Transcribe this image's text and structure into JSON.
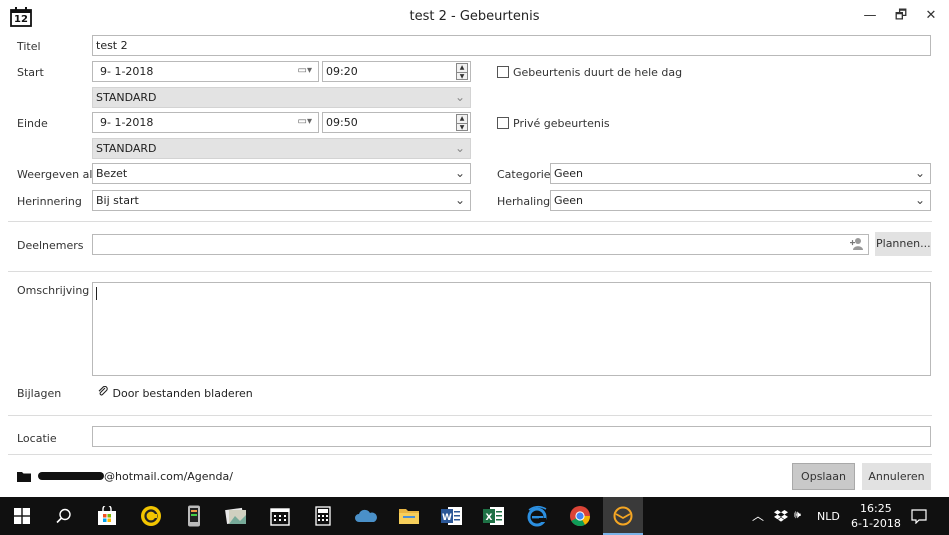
{
  "window": {
    "title": "test 2 - Gebeurtenis",
    "app_icon_text": "12",
    "controls": {
      "minimize": "—",
      "maximize": "🗗",
      "close": "✕"
    }
  },
  "form": {
    "title_label": "Titel",
    "title_value": "test 2",
    "start_label": "Start",
    "start_date": "9-  1-2018",
    "start_time": "09:20",
    "start_timezone": "STANDARD",
    "allday_label": "Gebeurtenis duurt de hele dag",
    "end_label": "Einde",
    "end_date": "9-  1-2018",
    "end_time": "09:50",
    "end_timezone": "STANDARD",
    "private_label": "Privé gebeurtenis",
    "show_as_label": "Weergeven als",
    "show_as_value": "Bezet",
    "category_label": "Categorie",
    "category_value": "Geen",
    "reminder_label": "Herinnering",
    "reminder_value": "Bij start",
    "repeat_label": "Herhaling",
    "repeat_value": "Geen",
    "attendees_label": "Deelnemers",
    "attendees_value": "",
    "plan_button": "Plannen...",
    "description_label": "Omschrijving",
    "description_value": "",
    "attachments_label": "Bijlagen",
    "attachments_link": "Door bestanden bladeren",
    "location_label": "Locatie",
    "location_value": ""
  },
  "footer": {
    "account_path": "@hotmail.com/Agenda/",
    "save_button": "Opslaan",
    "cancel_button": "Annuleren"
  },
  "taskbar": {
    "language": "NLD",
    "time": "16:25",
    "date": "6-1-2018"
  },
  "colors": {
    "taskbar_bg": "#101010",
    "field_border": "#b9b9b9",
    "disabled_field": "#e3e3e3",
    "button_bg": "#e2e2e2",
    "active_app_highlight": "#3a3a3a"
  }
}
